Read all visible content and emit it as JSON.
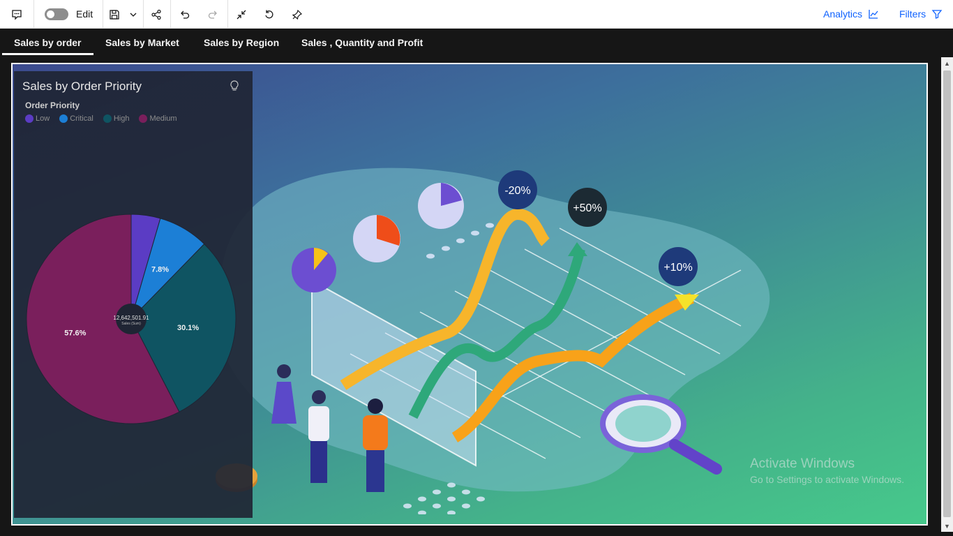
{
  "toolbar": {
    "edit_label": "Edit",
    "analytics_label": "Analytics",
    "filters_label": "Filters"
  },
  "tabs": [
    {
      "label": "Sales by order",
      "active": true
    },
    {
      "label": "Sales by Market",
      "active": false
    },
    {
      "label": "Sales by Region",
      "active": false
    },
    {
      "label": "Sales , Quantity and Profit",
      "active": false
    }
  ],
  "widget": {
    "title": "Sales by Order Priority",
    "legend_title": "Order Priority"
  },
  "chart_data": {
    "type": "pie",
    "title": "Sales by Order Priority",
    "legend_title": "Order Priority",
    "legend": [
      "Low",
      "Critical",
      "High",
      "Medium"
    ],
    "slices": [
      {
        "label": "Low",
        "percent": 4.5,
        "color": "#5b3cc4",
        "show_label": false
      },
      {
        "label": "Critical",
        "percent": 7.8,
        "color": "#1c7fd6",
        "show_label": true
      },
      {
        "label": "High",
        "percent": 30.1,
        "color": "#0f5462",
        "show_label": true
      },
      {
        "label": "Medium",
        "percent": 57.6,
        "color": "#7a1f5c",
        "show_label": true
      }
    ],
    "center_value": "12,642,501.91",
    "center_label": "Sales (Sum)"
  },
  "infographic": {
    "badges": [
      "-20%",
      "+50%",
      "+10%"
    ]
  },
  "watermark": {
    "line1": "Activate Windows",
    "line2": "Go to Settings to activate Windows."
  }
}
